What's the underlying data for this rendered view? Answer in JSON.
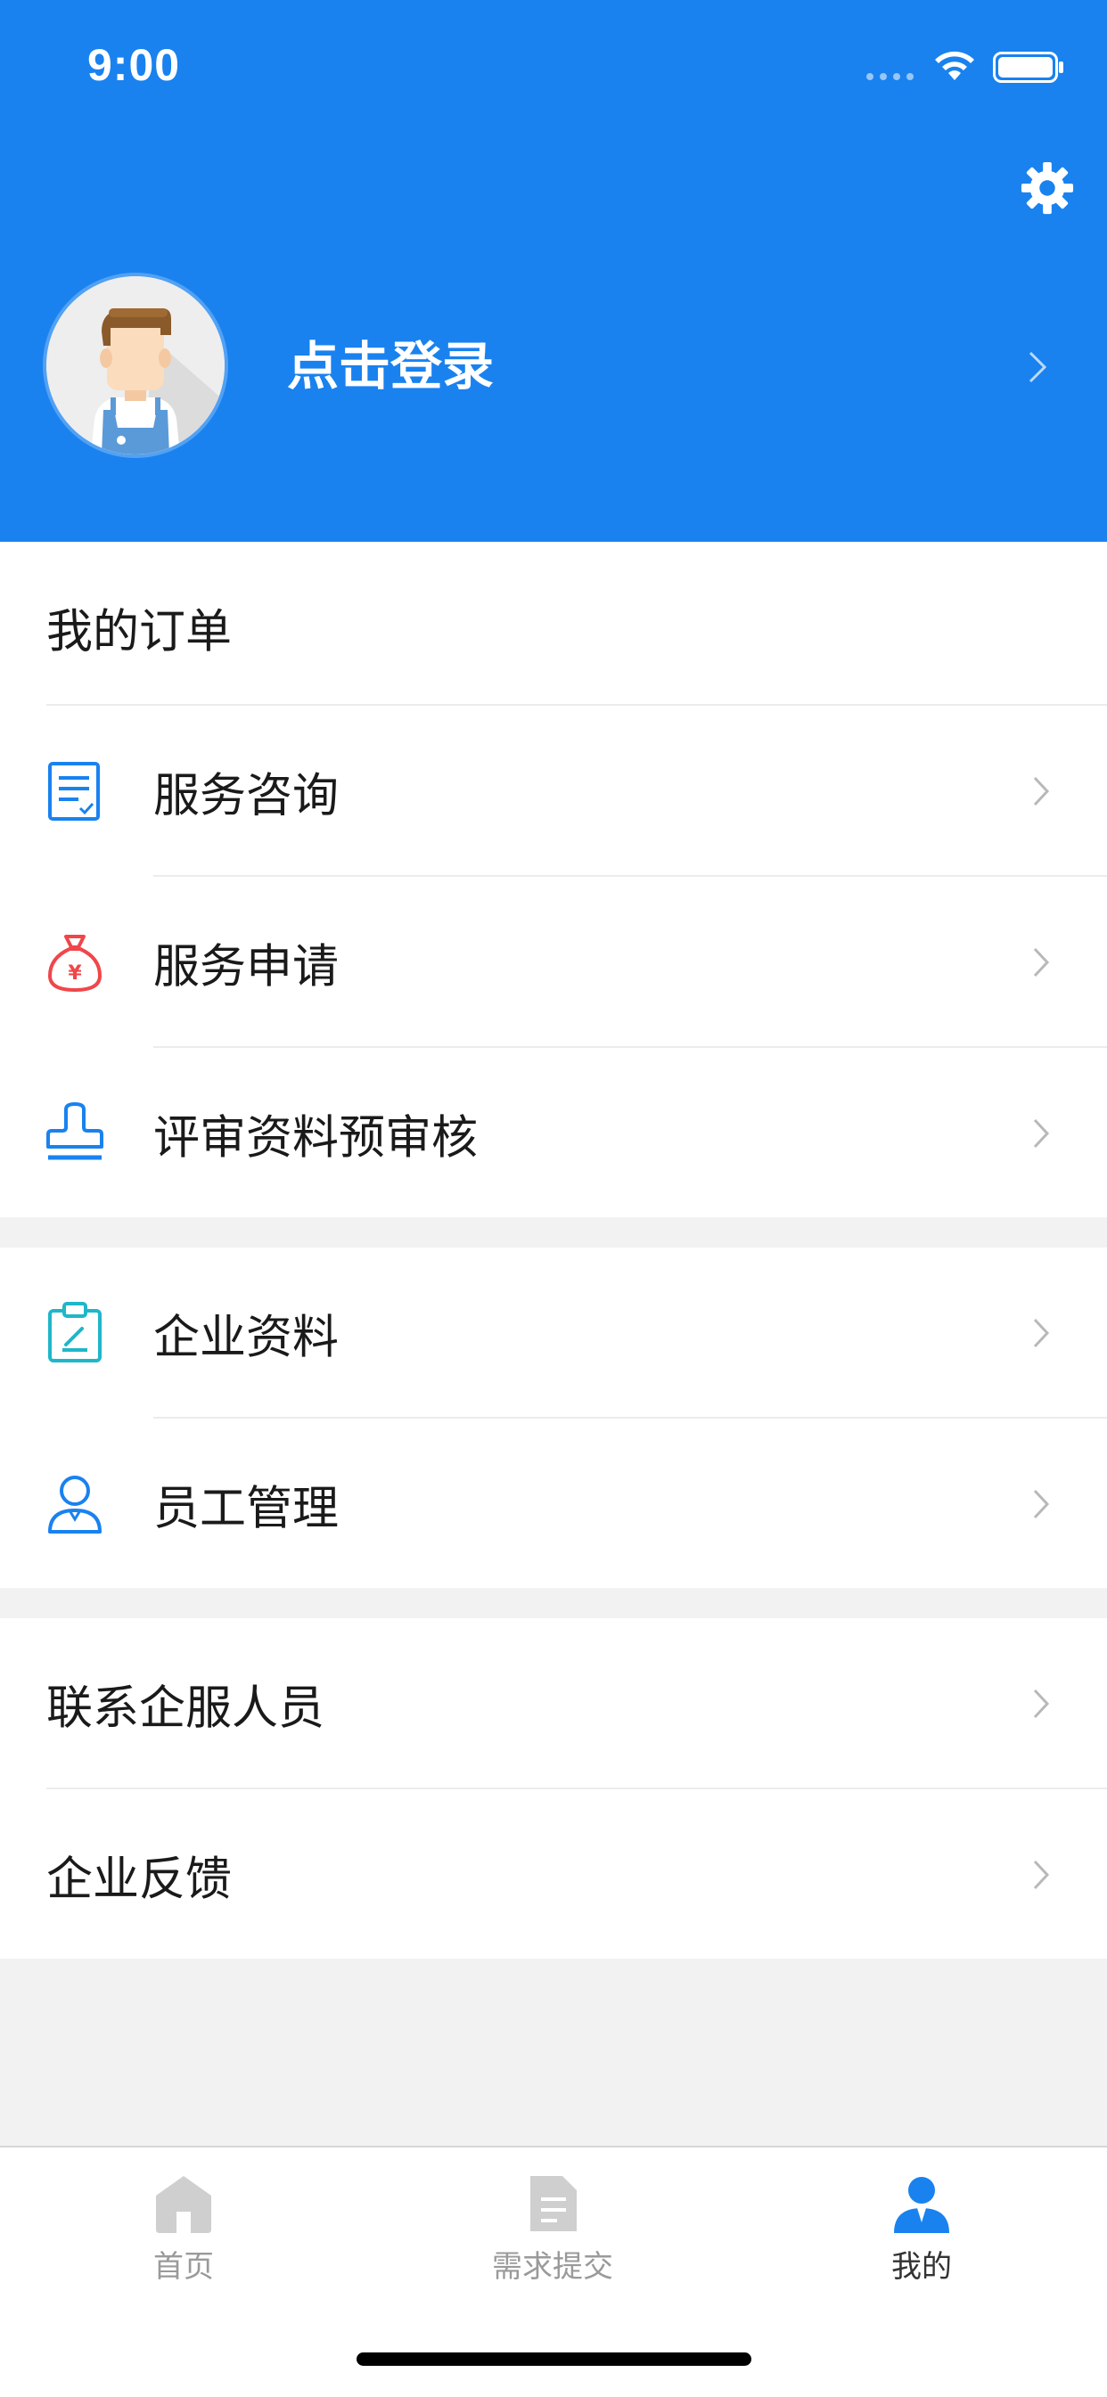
{
  "status_bar": {
    "time": "9:00"
  },
  "header": {
    "login_label": "点击登录",
    "background_color": "#1982ef",
    "settings_icon": "gear-icon",
    "avatar_icon": "worker-avatar"
  },
  "orders": {
    "title": "我的订单",
    "items": [
      {
        "label": "服务咨询",
        "icon": "document-check-icon",
        "icon_color": "#1982ef"
      },
      {
        "label": "服务申请",
        "icon": "money-bag-icon",
        "icon_color": "#f0464a"
      },
      {
        "label": "评审资料预审核",
        "icon": "stamp-icon",
        "icon_color": "#1982ef"
      }
    ]
  },
  "company": {
    "items": [
      {
        "label": "企业资料",
        "icon": "clipboard-edit-icon",
        "icon_color": "#1fb6c9"
      },
      {
        "label": "员工管理",
        "icon": "user-icon",
        "icon_color": "#1982ef"
      }
    ]
  },
  "contact": {
    "items": [
      {
        "label": "联系企服人员"
      },
      {
        "label": "企业反馈"
      }
    ]
  },
  "tabbar": {
    "tabs": [
      {
        "label": "首页",
        "icon": "home-icon",
        "active": false
      },
      {
        "label": "需求提交",
        "icon": "document-icon",
        "active": false
      },
      {
        "label": "我的",
        "icon": "profile-icon",
        "active": true
      }
    ],
    "active_color": "#1982ef",
    "inactive_color": "#cfcfcf"
  }
}
